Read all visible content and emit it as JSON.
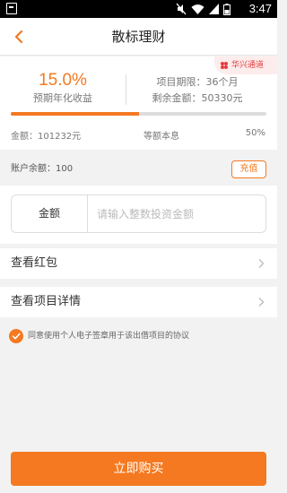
{
  "status_bar": {
    "time": "3:47",
    "icons": [
      "notification-app-icon",
      "mute-icon",
      "wifi-icon",
      "signal-icon",
      "battery-icon"
    ]
  },
  "header": {
    "title": "散标理财",
    "back_icon": "chevron-left-icon"
  },
  "product": {
    "badge": "华兴通道",
    "rate": "15.0%",
    "rate_label": "预期年化收益",
    "term": "项目期限：36个月",
    "remaining": "剩余金额：50330元",
    "progress_percent": 50,
    "amount": "金额：101232元",
    "repayment_method": "等额本息",
    "percent_text": "50%"
  },
  "account": {
    "balance_text": "账户余额：100",
    "recharge_label": "充值"
  },
  "invest": {
    "amount_label": "金额",
    "amount_placeholder": "请输入整数投资金额",
    "amount_value": ""
  },
  "menu": [
    {
      "label": "查看红包"
    },
    {
      "label": "查看项目详情"
    }
  ],
  "agreement": {
    "checked": true,
    "text": "同意使用个人电子签章用于该出借项目的协议"
  },
  "actions": {
    "buy_label": "立即购买"
  },
  "colors": {
    "accent": "#f47920",
    "badge_text": "#e43c3c",
    "badge_bg": "#fdecec"
  }
}
